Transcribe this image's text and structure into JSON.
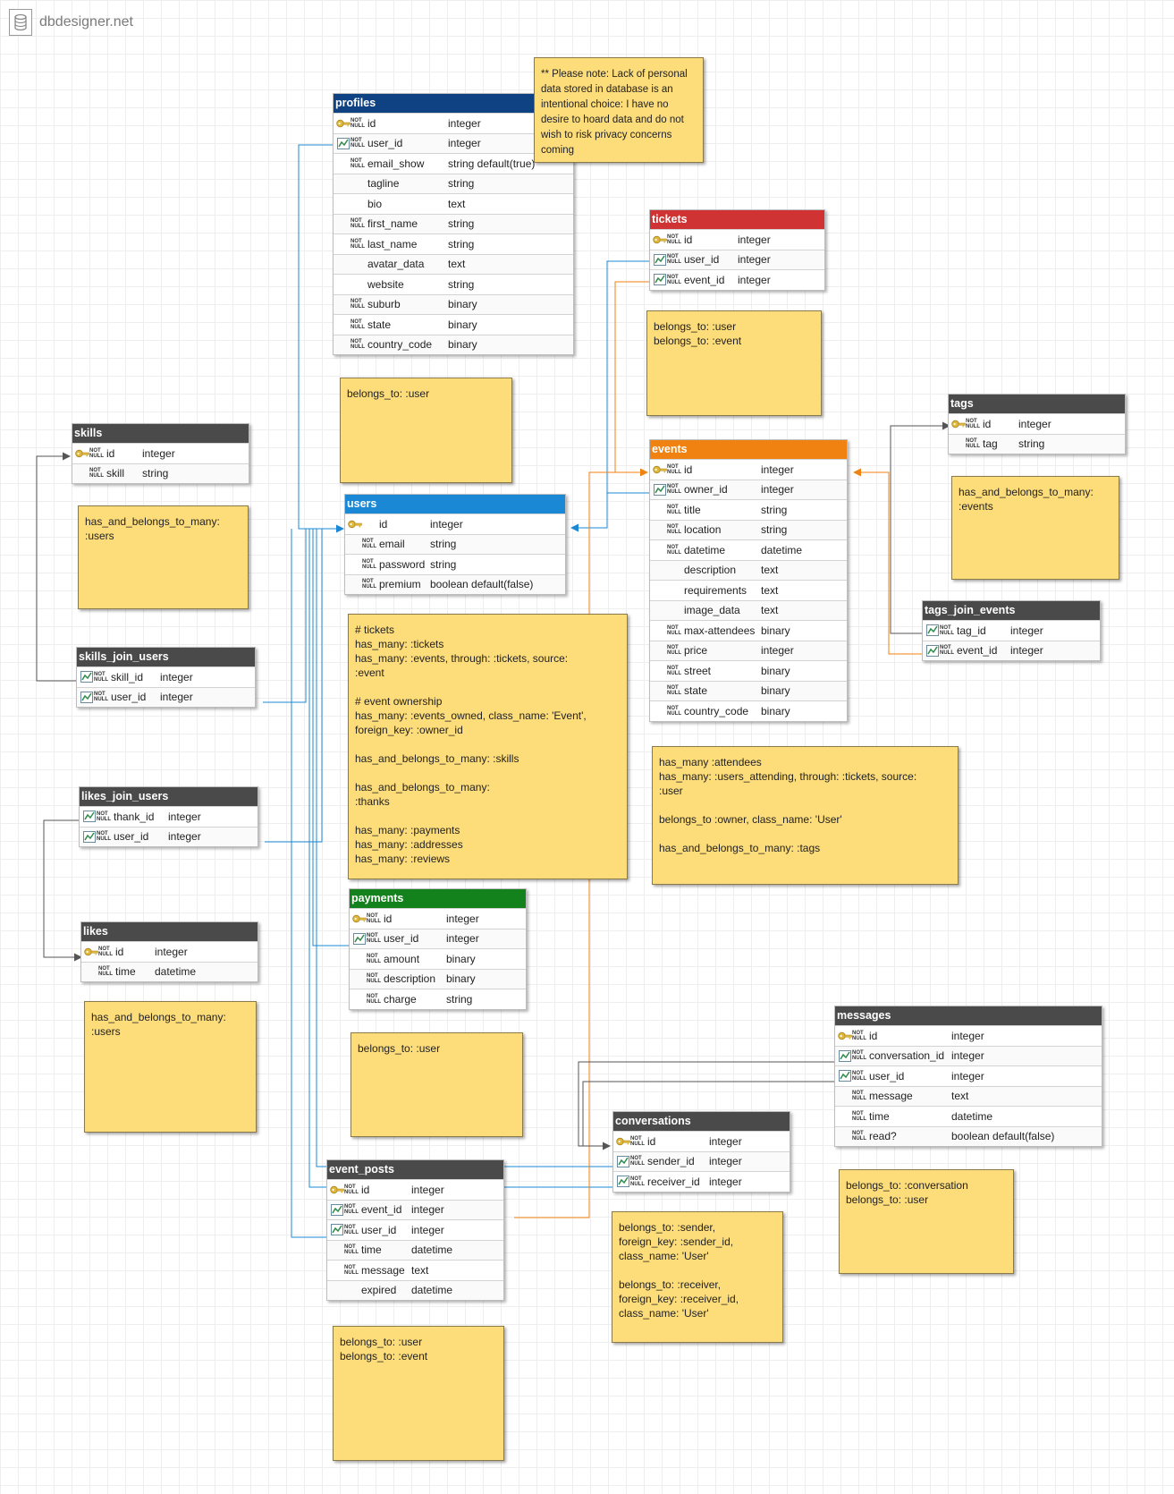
{
  "brand": {
    "name": "dbdesigner.net",
    "icon": "database-icon"
  },
  "colors": {
    "tag_blue": "#1b88d6",
    "tag_orange": "#f08212",
    "tag_gray": "#555555",
    "key": "#e0b83c",
    "note": "#fddc7a"
  },
  "nn": "NOT NULL",
  "tables": {
    "profiles": {
      "title": "profiles",
      "color": "#0f4283",
      "fields": [
        {
          "name": "id",
          "type": "integer",
          "icon": "pk",
          "nn": true
        },
        {
          "name": "user_id",
          "type": "integer",
          "icon": "fk",
          "nn": true
        },
        {
          "name": "email_show",
          "type": "string default(true)",
          "nn": true
        },
        {
          "name": "tagline",
          "type": "string"
        },
        {
          "name": "bio",
          "type": "text"
        },
        {
          "name": "first_name",
          "type": "string",
          "nn": true
        },
        {
          "name": "last_name",
          "type": "string",
          "nn": true
        },
        {
          "name": "avatar_data",
          "type": "text"
        },
        {
          "name": "website",
          "type": "string"
        },
        {
          "name": "suburb",
          "type": "binary",
          "nn": true
        },
        {
          "name": "state",
          "type": "binary",
          "nn": true
        },
        {
          "name": "country_code",
          "type": "binary",
          "nn": true
        }
      ]
    },
    "tickets": {
      "title": "tickets",
      "color": "#cf3333",
      "fields": [
        {
          "name": "id",
          "type": "integer",
          "icon": "pk",
          "nn": true
        },
        {
          "name": "user_id",
          "type": "integer",
          "icon": "fk",
          "nn": true
        },
        {
          "name": "event_id",
          "type": "integer",
          "icon": "fk",
          "nn": true
        }
      ]
    },
    "tags": {
      "title": "tags",
      "color": "#4a4a4a",
      "fields": [
        {
          "name": "id",
          "type": "integer",
          "icon": "pk",
          "nn": true
        },
        {
          "name": "tag",
          "type": "string",
          "nn": true
        }
      ]
    },
    "skills": {
      "title": "skills",
      "color": "#4a4a4a",
      "fields": [
        {
          "name": "id",
          "type": "integer",
          "icon": "pk",
          "nn": true
        },
        {
          "name": "skill",
          "type": "string",
          "nn": true
        }
      ]
    },
    "users": {
      "title": "users",
      "color": "#1b88d6",
      "fields": [
        {
          "name": "id",
          "type": "integer",
          "icon": "pk"
        },
        {
          "name": "email",
          "type": "string",
          "nn": true
        },
        {
          "name": "password",
          "type": "string",
          "nn": true
        },
        {
          "name": "premium",
          "type": "boolean default(false)",
          "nn": true
        }
      ]
    },
    "events": {
      "title": "events",
      "color": "#f08212",
      "fields": [
        {
          "name": "id",
          "type": "integer",
          "icon": "pk",
          "nn": true
        },
        {
          "name": "owner_id",
          "type": "integer",
          "icon": "fk",
          "nn": true
        },
        {
          "name": "title",
          "type": "string",
          "nn": true
        },
        {
          "name": "location",
          "type": "string",
          "nn": true
        },
        {
          "name": "datetime",
          "type": "datetime",
          "nn": true
        },
        {
          "name": "description",
          "type": "text"
        },
        {
          "name": "requirements",
          "type": "text"
        },
        {
          "name": "image_data",
          "type": "text"
        },
        {
          "name": "max-attendees",
          "type": "binary",
          "nn": true
        },
        {
          "name": "price",
          "type": "integer",
          "nn": true
        },
        {
          "name": "street",
          "type": "binary",
          "nn": true
        },
        {
          "name": "state",
          "type": "binary",
          "nn": true
        },
        {
          "name": "country_code",
          "type": "binary",
          "nn": true
        }
      ]
    },
    "tags_join_events": {
      "title": "tags_join_events",
      "color": "#4a4a4a",
      "fields": [
        {
          "name": "tag_id",
          "type": "integer",
          "icon": "fk",
          "nn": true
        },
        {
          "name": "event_id",
          "type": "integer",
          "icon": "fk",
          "nn": true
        }
      ]
    },
    "skills_join_users": {
      "title": "skills_join_users",
      "color": "#4a4a4a",
      "fields": [
        {
          "name": "skill_id",
          "type": "integer",
          "icon": "fk",
          "nn": true
        },
        {
          "name": "user_id",
          "type": "integer",
          "icon": "fk",
          "nn": true
        }
      ]
    },
    "likes_join_users": {
      "title": "likes_join_users",
      "color": "#4a4a4a",
      "fields": [
        {
          "name": "thank_id",
          "type": "integer",
          "icon": "fk",
          "nn": true
        },
        {
          "name": "user_id",
          "type": "integer",
          "icon": "fk",
          "nn": true
        }
      ]
    },
    "likes": {
      "title": "likes",
      "color": "#4a4a4a",
      "fields": [
        {
          "name": "id",
          "type": "integer",
          "icon": "pk",
          "nn": true
        },
        {
          "name": "time",
          "type": "datetime",
          "nn": true
        }
      ]
    },
    "payments": {
      "title": "payments",
      "color": "#14821c",
      "fields": [
        {
          "name": "id",
          "type": "integer",
          "icon": "pk",
          "nn": true
        },
        {
          "name": "user_id",
          "type": "integer",
          "icon": "fk",
          "nn": true
        },
        {
          "name": "amount",
          "type": "binary",
          "nn": true
        },
        {
          "name": "description",
          "type": "binary",
          "nn": true
        },
        {
          "name": "charge",
          "type": "string",
          "nn": true
        }
      ]
    },
    "messages": {
      "title": "messages",
      "color": "#4a4a4a",
      "fields": [
        {
          "name": "id",
          "type": "integer",
          "icon": "pk",
          "nn": true
        },
        {
          "name": "conversation_id",
          "type": "integer",
          "icon": "fk",
          "nn": true
        },
        {
          "name": "user_id",
          "type": "integer",
          "icon": "fk",
          "nn": true
        },
        {
          "name": "message",
          "type": "text",
          "nn": true
        },
        {
          "name": "time",
          "type": "datetime",
          "nn": true
        },
        {
          "name": "read?",
          "type": "boolean default(false)",
          "nn": true
        }
      ]
    },
    "conversations": {
      "title": "conversations",
      "color": "#4a4a4a",
      "fields": [
        {
          "name": "id",
          "type": "integer",
          "icon": "pk",
          "nn": true
        },
        {
          "name": "sender_id",
          "type": "integer",
          "icon": "fk",
          "nn": true
        },
        {
          "name": "receiver_id",
          "type": "integer",
          "icon": "fk",
          "nn": true
        }
      ]
    },
    "event_posts": {
      "title": "event_posts",
      "color": "#4a4a4a",
      "fields": [
        {
          "name": "id",
          "type": "integer",
          "icon": "pk",
          "nn": true
        },
        {
          "name": "event_id",
          "type": "integer",
          "icon": "fk",
          "nn": true
        },
        {
          "name": "user_id",
          "type": "integer",
          "icon": "fk",
          "nn": true
        },
        {
          "name": "time",
          "type": "datetime",
          "nn": true
        },
        {
          "name": "message",
          "type": "text",
          "nn": true
        },
        {
          "name": "expired",
          "type": "datetime"
        }
      ]
    }
  },
  "notes": {
    "privacy": "** Please note: Lack of personal data stored in database is an intentional choice: I have no desire to hoard data and do not wish to risk privacy concerns coming",
    "tickets": "belongs_to: :user\nbelongs_to: :event",
    "profiles": "belongs_to: :user",
    "tags": "has_and_belongs_to_many:\n:events",
    "skills": "has_and_belongs_to_many:\n:users",
    "users": "# tickets\nhas_many: :tickets\nhas_many: :events, through: :tickets, source:\n:event\n\n# event ownership\nhas_many: :events_owned, class_name: 'Event',\nforeign_key: :owner_id\n\nhas_and_belongs_to_many: :skills\n\nhas_and_belongs_to_many:\n:thanks\n\nhas_many: :payments\nhas_many: :addresses\nhas_many: :reviews",
    "events": "has_many :attendees\nhas_many: :users_attending, through: :tickets, source:\n:user\n\nbelongs_to :owner, class_name: 'User'\n\nhas_and_belongs_to_many: :tags",
    "likes": "has_and_belongs_to_many:\n:users",
    "payments": "belongs_to: :user",
    "messages": "belongs_to: :conversation\nbelongs_to: :user",
    "conversations": "belongs_to: :sender,\nforeign_key: :sender_id,\nclass_name: 'User'\n\nbelongs_to: :receiver,\nforeign_key: :receiver_id,\nclass_name: 'User'",
    "event_posts": "belongs_to: :user\nbelongs_to: :event"
  }
}
